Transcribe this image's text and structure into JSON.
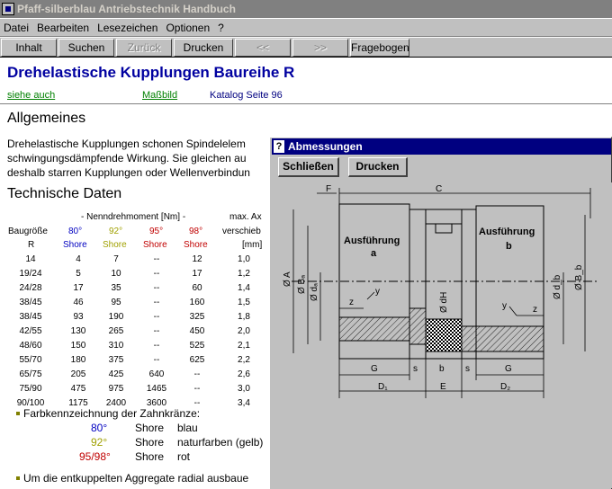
{
  "window": {
    "title": "Pfaff-silberblau Antriebstechnik Handbuch"
  },
  "menu": [
    "Datei",
    "Bearbeiten",
    "Lesezeichen",
    "Optionen",
    "?"
  ],
  "toolbar": {
    "inhalt": "Inhalt",
    "suchen": "Suchen",
    "zurueck": "Zurück",
    "drucken": "Drucken",
    "back": "<<",
    "forward": ">>",
    "fragebogen": "Fragebogen"
  },
  "page": {
    "title": "Drehelastische Kupplungen Baureihe R",
    "links": {
      "siehe_auch": "siehe auch",
      "massbild": "Maßbild",
      "katalog": "Katalog Seite 96"
    },
    "allgemeines": {
      "heading": "Allgemeines",
      "lines": [
        "Drehelastische Kupplungen schonen Spindelelem",
        "schwingungsdämpfende Wirkung. Sie gleichen au",
        "deshalb starren Kupplungen oder Wellenverbindun"
      ]
    },
    "technische_daten": {
      "heading": "Technische Daten",
      "group_header": "- Nenndrehmoment [Nm] -",
      "max_header": "max. Ax",
      "verschieb": "verschieb",
      "unit": "[mm]",
      "baugroesse": "Baugröße",
      "r_label": "R",
      "shore": "Shore",
      "cols": [
        "80°",
        "92°",
        "95°",
        "98°"
      ],
      "rows": [
        [
          "14",
          "4",
          "7",
          "--",
          "12",
          "1,0"
        ],
        [
          "19/24",
          "5",
          "10",
          "--",
          "17",
          "1,2"
        ],
        [
          "24/28",
          "17",
          "35",
          "--",
          "60",
          "1,4"
        ],
        [
          "38/45",
          "46",
          "95",
          "--",
          "160",
          "1,5"
        ],
        [
          "38/45",
          "93",
          "190",
          "--",
          "325",
          "1,8"
        ],
        [
          "42/55",
          "130",
          "265",
          "--",
          "450",
          "2,0"
        ],
        [
          "48/60",
          "150",
          "310",
          "--",
          "525",
          "2,1"
        ],
        [
          "55/70",
          "180",
          "375",
          "--",
          "625",
          "2,2"
        ],
        [
          "65/75",
          "205",
          "425",
          "640",
          "--",
          "2,6"
        ],
        [
          "75/90",
          "475",
          "975",
          "1465",
          "--",
          "3,0"
        ],
        [
          "90/100",
          "1175",
          "2400",
          "3600",
          "--",
          "3,4"
        ]
      ]
    },
    "farbkennzeichnung": {
      "text": "Farbkennzeichnung der Zahnkränze:",
      "items": [
        {
          "degree": "80°",
          "shore": "Shore",
          "color_name": "blau"
        },
        {
          "degree": "92°",
          "shore": "Shore",
          "color_name": "naturfarben (gelb)"
        },
        {
          "degree": "95/98°",
          "shore": "Shore",
          "color_name": "rot"
        }
      ]
    },
    "aggregate": "Um die entkuppelten Aggregate radial ausbaue"
  },
  "dialog": {
    "title": "Abmessungen",
    "close": "Schließen",
    "print": "Drucken",
    "drawing": {
      "F": "F",
      "C": "C",
      "ausf_a_1": "Ausführung",
      "ausf_a_2": "a",
      "ausf_b_1": "Ausführung",
      "ausf_b_2": "b",
      "OA": "Ø A",
      "OBa": "Ø Bₐ",
      "Oda": "Ø dₐ",
      "OdH": "Ø dH",
      "Odb": "Ø d_b",
      "OBb": "Ø B_b",
      "z": "z",
      "y": "y",
      "G": "G",
      "s": "s",
      "b": "b",
      "D1": "D₁",
      "E": "E",
      "D2": "D₂"
    }
  },
  "colors": {
    "title_blue": "#0000a0",
    "link_green": "#008000",
    "shore80": "#0000c0",
    "shore92": "#a0a000",
    "shore95": "#c00000",
    "dialog_title": "#000080",
    "bullet": "#808000"
  }
}
